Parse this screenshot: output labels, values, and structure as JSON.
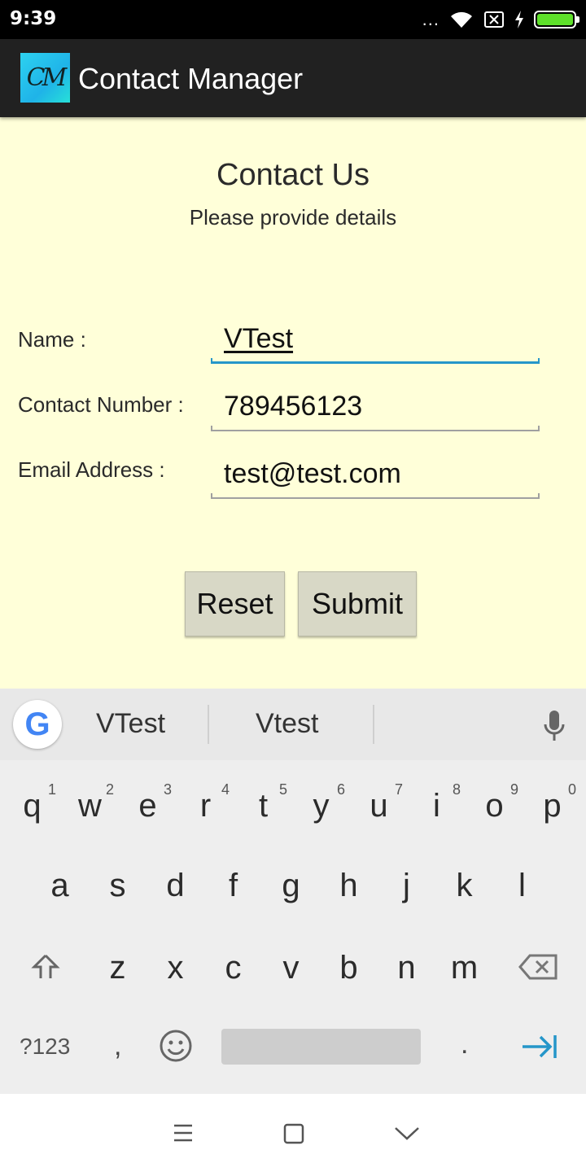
{
  "status_bar": {
    "time": "9:39",
    "dots": "...",
    "icons": [
      "wifi-icon",
      "no-sim-icon",
      "charging-icon",
      "battery-icon"
    ],
    "battery_color": "#5ee02a"
  },
  "app_bar": {
    "logo_text": "CM",
    "title": "Contact Manager"
  },
  "form": {
    "heading": "Contact Us",
    "subheading": "Please provide details",
    "fields": [
      {
        "label": "Name :",
        "value": "VTest"
      },
      {
        "label": "Contact Number :",
        "value": "789456123"
      },
      {
        "label": "Email Address :",
        "value": "test@test.com"
      }
    ],
    "reset_label": "Reset",
    "submit_label": "Submit"
  },
  "keyboard": {
    "google_icon": "G",
    "suggestions": [
      "VTest",
      "Vtest"
    ],
    "row1": [
      "q",
      "w",
      "e",
      "r",
      "t",
      "y",
      "u",
      "i",
      "o",
      "p"
    ],
    "row1_hints": [
      "1",
      "2",
      "3",
      "4",
      "5",
      "6",
      "7",
      "8",
      "9",
      "0"
    ],
    "row2": [
      "a",
      "s",
      "d",
      "f",
      "g",
      "h",
      "j",
      "k",
      "l"
    ],
    "row3": [
      "z",
      "x",
      "c",
      "v",
      "b",
      "n",
      "m"
    ],
    "symbols_label": "?123",
    "comma": ",",
    "period": ".",
    "accent_color": "#2596c9"
  },
  "nav_bar": {
    "icons": [
      "menu-icon",
      "home-icon",
      "back-icon"
    ]
  }
}
